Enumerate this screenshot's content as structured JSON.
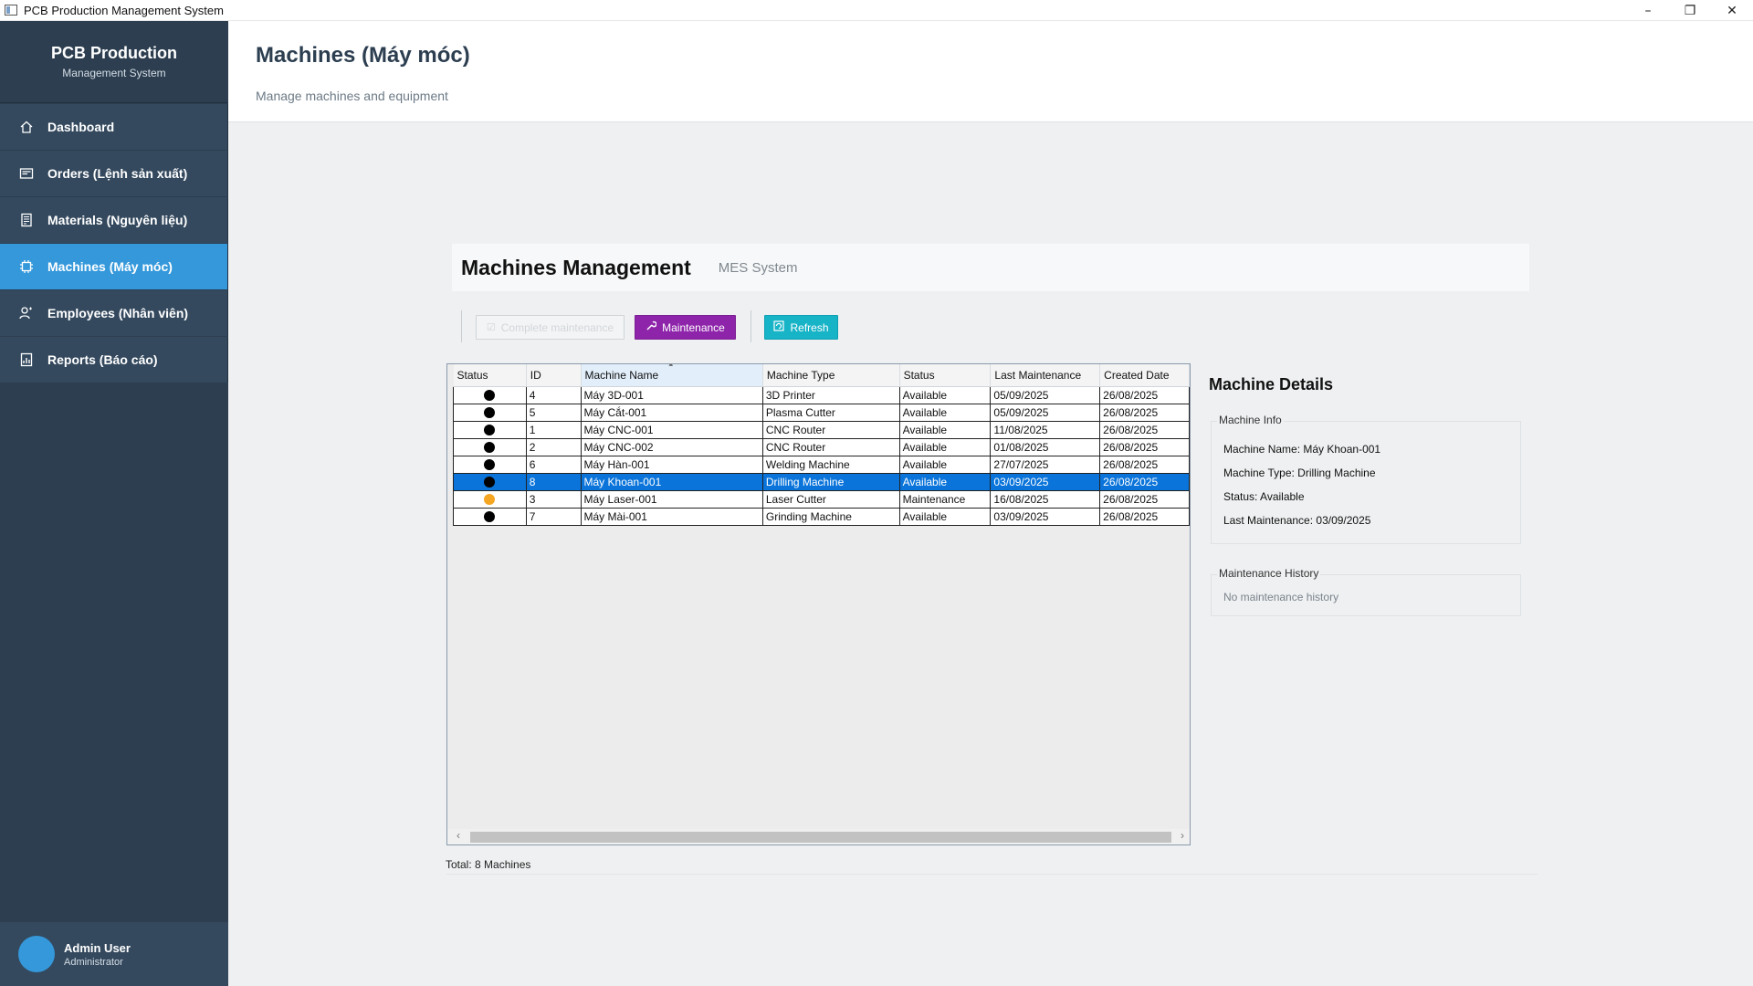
{
  "window": {
    "title": "PCB Production Management System",
    "minimize": "–",
    "maximize": "❐",
    "close": "✕"
  },
  "brand": {
    "title": "PCB Production",
    "subtitle": "Management System"
  },
  "nav": [
    {
      "label": "Dashboard",
      "icon": "home-icon",
      "active": false
    },
    {
      "label": "Orders (Lệnh sản xuất)",
      "icon": "orders-icon",
      "active": false
    },
    {
      "label": "Materials (Nguyên liệu)",
      "icon": "materials-icon",
      "active": false
    },
    {
      "label": "Machines (Máy móc)",
      "icon": "chip-icon",
      "active": true
    },
    {
      "label": "Employees (Nhân viên)",
      "icon": "employees-icon",
      "active": false
    },
    {
      "label": "Reports (Báo cáo)",
      "icon": "report-icon",
      "active": false
    }
  ],
  "user": {
    "name": "Admin User",
    "role": "Administrator"
  },
  "header": {
    "title": "Machines (Máy móc)",
    "subtitle": "Manage machines and equipment"
  },
  "module": {
    "title": "Machines Management",
    "subtitle": "MES System"
  },
  "toolbar": {
    "complete_label": "Complete maintenance",
    "maintenance_label": "Maintenance",
    "refresh_label": "Refresh",
    "maintenance_icon": "wrench-icon",
    "refresh_icon": "refresh-icon"
  },
  "table": {
    "columns": [
      "Status",
      "ID",
      "Machine Name",
      "Machine Type",
      "Status",
      "Last Maintenance",
      "Created Date"
    ],
    "sorted_column": "Machine Name",
    "rows": [
      {
        "dot": "#000000",
        "id": "4",
        "name": "Máy 3D-001",
        "type": "3D Printer",
        "status": "Available",
        "last": "05/09/2025",
        "created": "26/08/2025",
        "selected": false
      },
      {
        "dot": "#000000",
        "id": "5",
        "name": "Máy Cắt-001",
        "type": "Plasma Cutter",
        "status": "Available",
        "last": "05/09/2025",
        "created": "26/08/2025",
        "selected": false
      },
      {
        "dot": "#000000",
        "id": "1",
        "name": "Máy CNC-001",
        "type": "CNC Router",
        "status": "Available",
        "last": "11/08/2025",
        "created": "26/08/2025",
        "selected": false
      },
      {
        "dot": "#000000",
        "id": "2",
        "name": "Máy CNC-002",
        "type": "CNC Router",
        "status": "Available",
        "last": "01/08/2025",
        "created": "26/08/2025",
        "selected": false
      },
      {
        "dot": "#000000",
        "id": "6",
        "name": "Máy Hàn-001",
        "type": "Welding Machine",
        "status": "Available",
        "last": "27/07/2025",
        "created": "26/08/2025",
        "selected": false
      },
      {
        "dot": "#000000",
        "id": "8",
        "name": "Máy Khoan-001",
        "type": "Drilling Machine",
        "status": "Available",
        "last": "03/09/2025",
        "created": "26/08/2025",
        "selected": true
      },
      {
        "dot": "#f5a623",
        "id": "3",
        "name": "Máy Laser-001",
        "type": "Laser Cutter",
        "status": "Maintenance",
        "last": "16/08/2025",
        "created": "26/08/2025",
        "selected": false
      },
      {
        "dot": "#000000",
        "id": "7",
        "name": "Máy Mài-001",
        "type": "Grinding Machine",
        "status": "Available",
        "last": "03/09/2025",
        "created": "26/08/2025",
        "selected": false
      }
    ]
  },
  "total": "Total: 8 Machines",
  "details": {
    "title": "Machine Details",
    "info_label": "Machine Info",
    "name_line": "Machine Name: Máy Khoan-001",
    "type_line": "Machine Type: Drilling Machine",
    "status_line": "Status: Available",
    "maint_line": "Last Maintenance: 03/09/2025",
    "history_label": "Maintenance History",
    "history_empty": "No maintenance history"
  },
  "colors": {
    "sidebar": "#2c3e50",
    "nav_item": "#34495e",
    "nav_active": "#3498db",
    "maintenance_btn": "#8e24aa",
    "refresh_btn": "#17b3c7",
    "selection": "#0a74da",
    "warning_dot": "#f5a623"
  }
}
